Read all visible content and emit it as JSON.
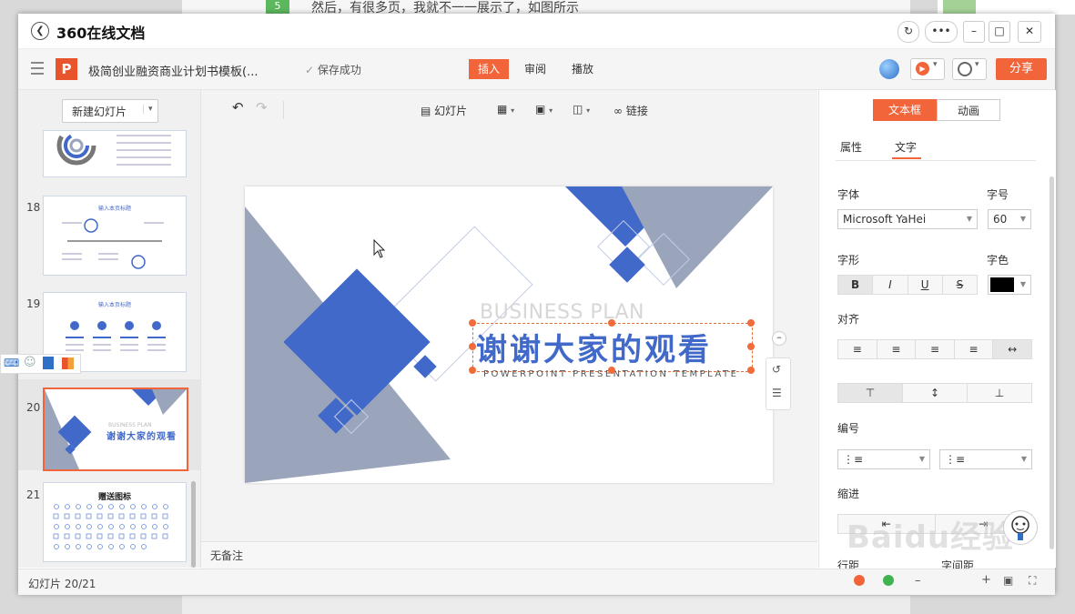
{
  "background": {
    "step_number": "5",
    "step_text": "然后，有很多页，我就不一一展示了，如图所示"
  },
  "window": {
    "title": "360在线文档"
  },
  "toolbar": {
    "logo_letter": "P",
    "doc_title": "极简创业融资商业计划书模板(...",
    "save_status": "保存成功",
    "tabs": [
      "插入",
      "审阅",
      "播放"
    ],
    "share_label": "分享"
  },
  "left_panel": {
    "new_slide_label": "新建幻灯片",
    "thumbs": [
      {
        "num": ""
      },
      {
        "num": "18",
        "title": "输入本页标题"
      },
      {
        "num": "19",
        "title": "输入本页标题"
      },
      {
        "num": "20",
        "mini_en": "BUSINESS PLAN",
        "mini_cn": "谢谢大家的观看"
      },
      {
        "num": "21",
        "title": "赠送图标"
      }
    ]
  },
  "canvas_toolbar": {
    "slide_label": "幻灯片",
    "link_label": "链接"
  },
  "slide": {
    "subtitle_en": "BUSINESS PLAN",
    "main_title": "谢谢大家的观看",
    "tagline": "POWERPOINT PRESENTATION TEMPLATE",
    "colors": {
      "blue": "#4169c9",
      "gray": "#9aa5bb"
    }
  },
  "notes": {
    "placeholder": "无备注"
  },
  "status": {
    "slide_count": "幻灯片 20/21"
  },
  "right_panel": {
    "tabs": [
      "文本框",
      "动画"
    ],
    "subtabs": [
      "属性",
      "文字"
    ],
    "font_label": "字体",
    "font_value": "Microsoft YaHei",
    "size_label": "字号",
    "size_value": "60",
    "style_label": "字形",
    "style_buttons": [
      "B",
      "I",
      "U",
      "S"
    ],
    "color_label": "字色",
    "color_value": "#000000",
    "align_label": "对齐",
    "numbering_label": "编号",
    "indent_label": "缩进",
    "line_spacing_label": "行距",
    "char_spacing_label": "字间距"
  },
  "watermark": {
    "text": "Baidu经验"
  }
}
